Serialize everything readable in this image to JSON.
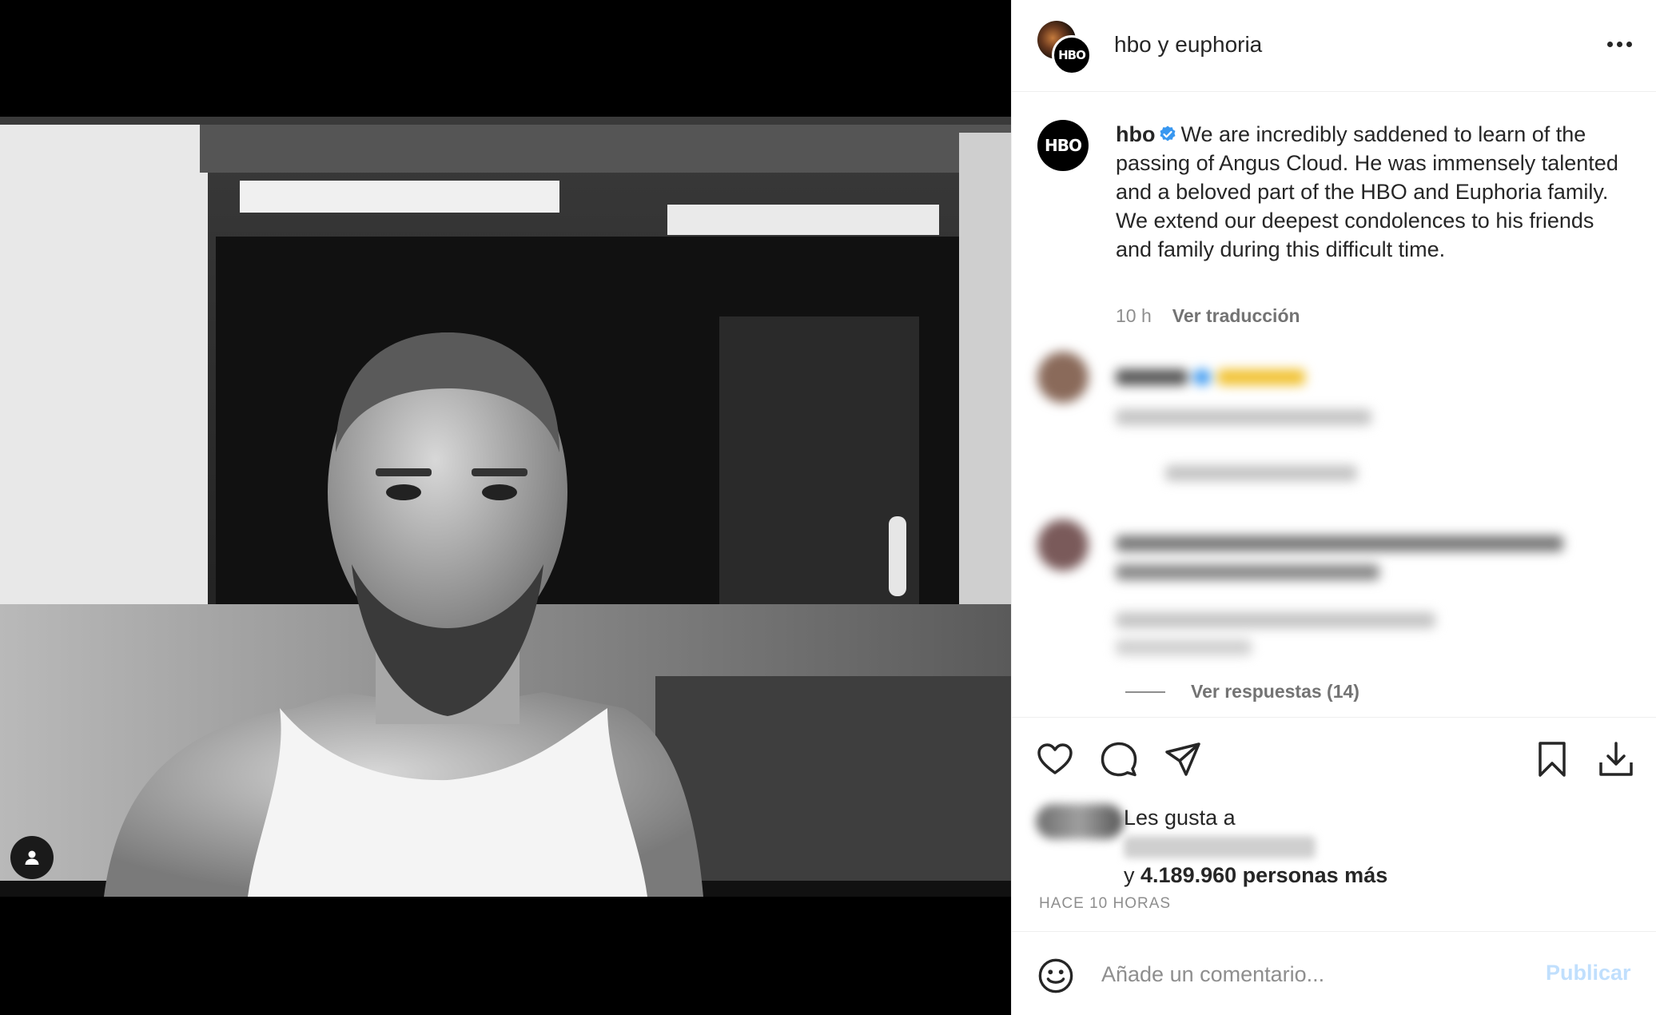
{
  "header": {
    "title": "hbo y euphoria",
    "avatar_front_text": "HBO",
    "more_icon": "more-horizontal-icon"
  },
  "caption": {
    "avatar_text": "HBO",
    "username": "hbo",
    "verified_icon": "verified-badge-icon",
    "text": "We are incredibly saddened to learn of the passing of Angus Cloud. He was immensely talented and a beloved part of the HBO and Euphoria family. We extend our deepest condolences to his friends and family during this difficult time.",
    "time": "10 h",
    "translate_label": "Ver traducción"
  },
  "comments": {
    "replies_label": "Ver respuestas (14)"
  },
  "actions": {
    "like_icon": "heart-icon",
    "comment_icon": "comment-icon",
    "share_icon": "share-icon",
    "save_icon": "bookmark-icon",
    "download_icon": "download-icon"
  },
  "likes": {
    "line1": "Les gusta a",
    "line2_prefix": "y ",
    "line2_bold": "4.189.960 personas más"
  },
  "timestamp": "HACE 10 HORAS",
  "comment_box": {
    "placeholder": "Añade un comentario...",
    "publish_label": "Publicar",
    "emoji_icon": "emoji-icon"
  },
  "photo": {
    "tag_icon": "user-tag-icon"
  },
  "colors": {
    "verified": "#3897f0",
    "publish_disabled": "#c0dffd",
    "muted_text": "#8e8e8e"
  }
}
